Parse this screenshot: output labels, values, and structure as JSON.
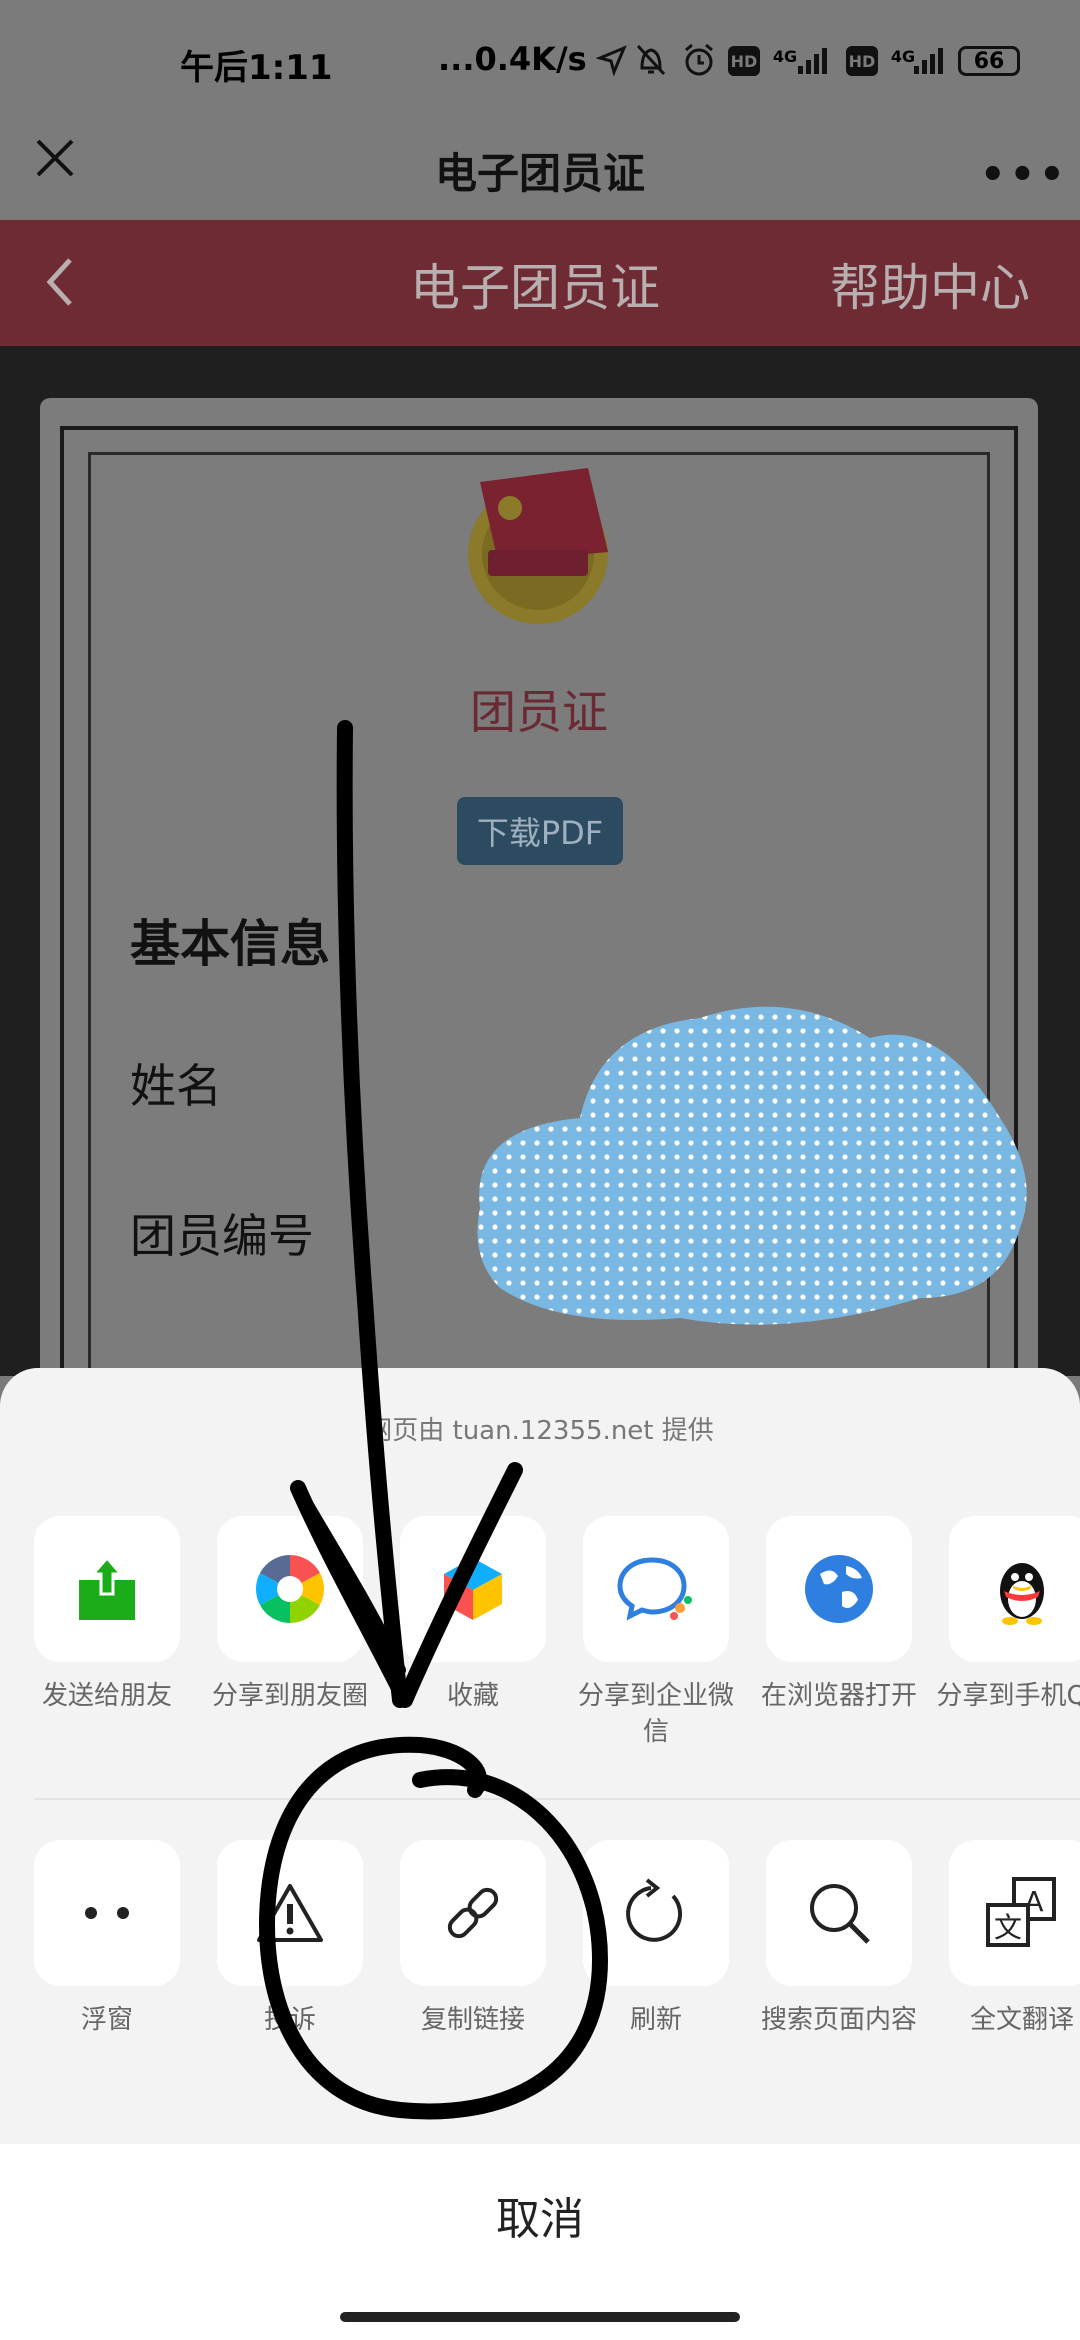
{
  "status_bar": {
    "time": "午后1:11",
    "network_speed": "...0.4K/s",
    "signal1": "4G",
    "signal2": "4G",
    "hd1": "HD",
    "hd2": "HD",
    "battery": "66"
  },
  "nav": {
    "title": "电子团员证",
    "more": "•••"
  },
  "header": {
    "title": "电子团员证",
    "help": "帮助中心"
  },
  "card": {
    "title": "团员证",
    "download_button": "下载PDF",
    "section_title": "基本信息",
    "name_label": "姓名",
    "member_id_label": "团员编号"
  },
  "sheet": {
    "provider": "网页由 tuan.12355.net 提供",
    "row1": [
      {
        "label": "发送给朋友",
        "icon": "send-to-friend-icon"
      },
      {
        "label": "分享到朋友圈",
        "icon": "moments-icon"
      },
      {
        "label": "收藏",
        "icon": "favorite-icon"
      },
      {
        "label": "分享到企业微信",
        "icon": "wecom-icon"
      },
      {
        "label": "在浏览器打开",
        "icon": "browser-icon"
      },
      {
        "label": "分享到手机QQ",
        "icon": "qq-icon"
      }
    ],
    "row2": [
      {
        "label": "浮窗",
        "icon": "float-window-icon"
      },
      {
        "label": "投诉",
        "icon": "complaint-icon"
      },
      {
        "label": "复制链接",
        "icon": "link-icon"
      },
      {
        "label": "刷新",
        "icon": "refresh-icon"
      },
      {
        "label": "搜索页面内容",
        "icon": "search-icon"
      },
      {
        "label": "全文翻译",
        "icon": "translate-icon"
      }
    ],
    "cancel": "取消"
  },
  "colors": {
    "header_red": "#6f2b33",
    "sheet_bg": "#f3f3f3",
    "cloud_blue": "#7ab8e4"
  }
}
